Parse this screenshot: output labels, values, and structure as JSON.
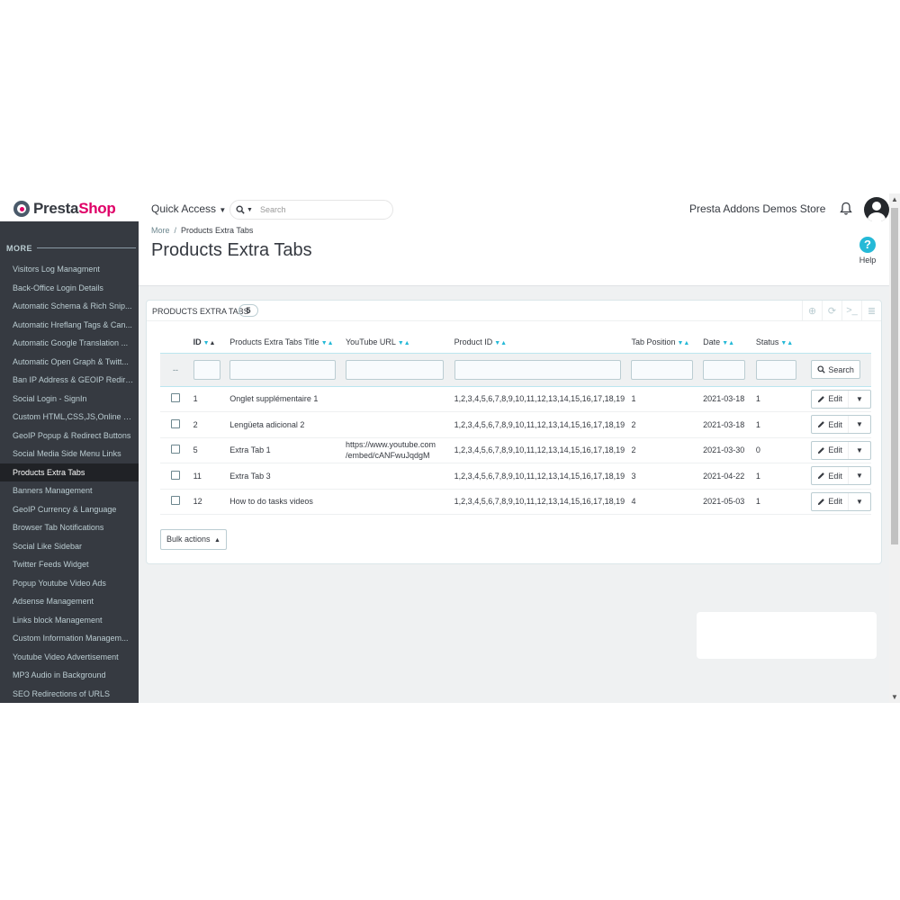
{
  "header": {
    "logo_prefix": "Presta",
    "logo_suffix": "Shop",
    "quick_access": "Quick Access",
    "search_placeholder": "Search",
    "store_name": "Presta Addons Demos Store"
  },
  "sidebar": {
    "title": "MORE",
    "items": [
      "Visitors Log Managment",
      "Back-Office Login Details",
      "Automatic Schema & Rich Snip...",
      "Automatic Hreflang Tags & Can...",
      "Automatic Google Translation ...",
      "Automatic Open Graph & Twitt...",
      "Ban IP Address & GEOIP Redirect",
      "Social Login - SignIn",
      "Custom HTML,CSS,JS,Online Ch...",
      "GeoIP Popup & Redirect Buttons",
      "Social Media Side Menu Links",
      "Products Extra Tabs",
      "Banners Management",
      "GeoIP Currency & Language",
      "Browser Tab Notifications",
      "Social Like Sidebar",
      "Twitter Feeds Widget",
      "Popup Youtube Video Ads",
      "Adsense Management",
      "Links block Management",
      "Custom Information Managem...",
      "Youtube Video Advertisement",
      "MP3 Audio in Background",
      "SEO Redirections of URLS"
    ],
    "active_index": 11
  },
  "breadcrumb": {
    "parent": "More",
    "separator": "/",
    "current": "Products Extra Tabs"
  },
  "page_title": "Products Extra Tabs",
  "help_label": "Help",
  "panel": {
    "title": "PRODUCTS EXTRA TABS",
    "count": "5"
  },
  "table": {
    "columns": [
      "ID",
      "Products Extra Tabs Title",
      "YouTube URL",
      "Product ID",
      "Tab Position",
      "Date",
      "Status"
    ],
    "filter_dash": "--",
    "search_label": "Search",
    "edit_label": "Edit",
    "rows": [
      {
        "id": "1",
        "title": "Onglet supplémentaire 1",
        "youtube": "",
        "product_id": "1,2,3,4,5,6,7,8,9,10,11,12,13,14,15,16,17,18,19",
        "position": "1",
        "date": "2021-03-18",
        "status": "1"
      },
      {
        "id": "2",
        "title": "Lengüeta adicional 2",
        "youtube": "",
        "product_id": "1,2,3,4,5,6,7,8,9,10,11,12,13,14,15,16,17,18,19",
        "position": "2",
        "date": "2021-03-18",
        "status": "1"
      },
      {
        "id": "5",
        "title": "Extra Tab 1",
        "youtube": "https://www.youtube.com/embed/cANFwuJqdgM",
        "youtube_line1": "https://www.youtube.com",
        "youtube_line2": "/embed/cANFwuJqdgM",
        "product_id": "1,2,3,4,5,6,7,8,9,10,11,12,13,14,15,16,17,18,19",
        "position": "2",
        "date": "2021-03-30",
        "status": "0"
      },
      {
        "id": "11",
        "title": "Extra Tab 3",
        "youtube": "",
        "product_id": "1,2,3,4,5,6,7,8,9,10,11,12,13,14,15,16,17,18,19",
        "position": "3",
        "date": "2021-04-22",
        "status": "1"
      },
      {
        "id": "12",
        "title": "How to do tasks videos",
        "youtube": "",
        "product_id": "1,2,3,4,5,6,7,8,9,10,11,12,13,14,15,16,17,18,19",
        "position": "4",
        "date": "2021-05-03",
        "status": "1"
      }
    ]
  },
  "bulk_actions": "Bulk actions",
  "colors": {
    "sidebar_bg": "#363a41",
    "accent": "#25b9d7",
    "brand_pink": "#df0067"
  }
}
